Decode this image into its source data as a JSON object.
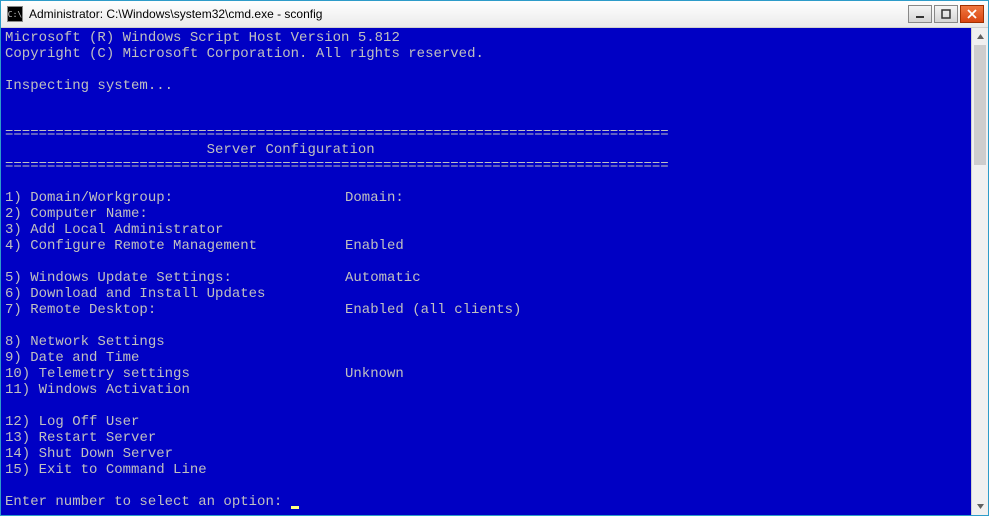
{
  "window": {
    "title": "Administrator: C:\\Windows\\system32\\cmd.exe - sconfig"
  },
  "header": {
    "line1": "Microsoft (R) Windows Script Host Version 5.812",
    "line2": "Copyright (C) Microsoft Corporation. All rights reserved.",
    "inspecting": "Inspecting system..."
  },
  "divider": "===============================================================================",
  "section_title": "                        Server Configuration",
  "menu": {
    "items": [
      {
        "num": "1)",
        "label": "Domain/Workgroup:",
        "value": "Domain:"
      },
      {
        "num": "2)",
        "label": "Computer Name:",
        "value": ""
      },
      {
        "num": "3)",
        "label": "Add Local Administrator",
        "value": ""
      },
      {
        "num": "4)",
        "label": "Configure Remote Management",
        "value": "Enabled"
      }
    ],
    "items2": [
      {
        "num": "5)",
        "label": "Windows Update Settings:",
        "value": "Automatic"
      },
      {
        "num": "6)",
        "label": "Download and Install Updates",
        "value": ""
      },
      {
        "num": "7)",
        "label": "Remote Desktop:",
        "value": "Enabled (all clients)"
      }
    ],
    "items3": [
      {
        "num": "8)",
        "label": "Network Settings",
        "value": ""
      },
      {
        "num": "9)",
        "label": "Date and Time",
        "value": ""
      },
      {
        "num": "10)",
        "label": "Telemetry settings",
        "value": "Unknown"
      },
      {
        "num": "11)",
        "label": "Windows Activation",
        "value": ""
      }
    ],
    "items4": [
      {
        "num": "12)",
        "label": "Log Off User",
        "value": ""
      },
      {
        "num": "13)",
        "label": "Restart Server",
        "value": ""
      },
      {
        "num": "14)",
        "label": "Shut Down Server",
        "value": ""
      },
      {
        "num": "15)",
        "label": "Exit to Command Line",
        "value": ""
      }
    ]
  },
  "prompt": "Enter number to select an option: "
}
